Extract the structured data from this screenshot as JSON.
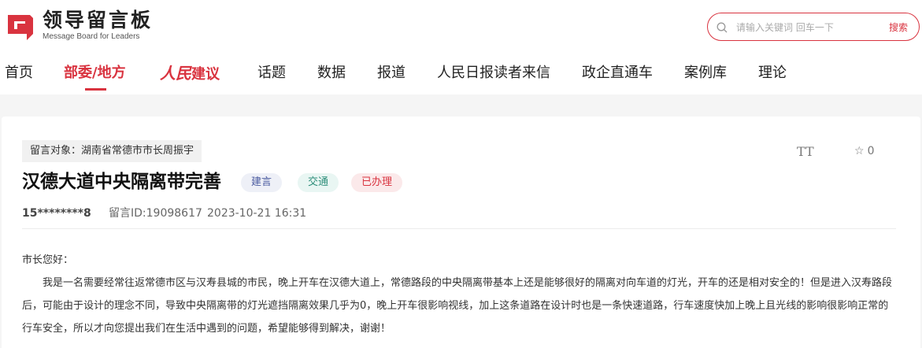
{
  "header": {
    "logo_title": "领导留言板",
    "logo_subtitle": "Message Board for Leaders",
    "search": {
      "placeholder": "请输入关键词 回车一下",
      "button_label": "搜索"
    }
  },
  "nav": {
    "items": [
      {
        "label": "首页"
      },
      {
        "label": "部委/地方",
        "active": true
      },
      {
        "label_brush": "人民",
        "label_rest": "建议"
      },
      {
        "label": "话题"
      },
      {
        "label": "数据"
      },
      {
        "label": "报道"
      },
      {
        "label": "人民日报读者来信"
      },
      {
        "label": "政企直通车"
      },
      {
        "label": "案例库"
      },
      {
        "label": "理论"
      }
    ]
  },
  "message": {
    "target": "留言对象：湖南省常德市市长周振宇",
    "font_size_label": "TT",
    "favorite_count": "0",
    "title": "汉德大道中央隔离带完善",
    "tags": [
      "建言",
      "交通",
      "已办理"
    ],
    "user": "15********8",
    "message_id": "留言ID:19098617",
    "time": "2023-10-21 16:31",
    "greeting": "市长您好：",
    "content": "我是一名需要经常往返常德市区与汉寿县城的市民，晚上开车在汉德大道上，常德路段的中央隔离带基本上还是能够很好的隔离对向车道的灯光，开车的还是相对安全的！但是进入汉寿路段后，可能由于设计的理念不同，导致中央隔离带的灯光遮挡隔离效果几乎为0，晚上开车很影响视线，加上这条道路在设计时也是一条快速道路，行车速度快加上晚上且光线的影响很影响正常的行车安全，所以才向您提出我们在生活中遇到的问题，希望能够得到解决，谢谢！"
  },
  "colors": {
    "accent": "#d9333f",
    "band": "#f5f5f5"
  }
}
